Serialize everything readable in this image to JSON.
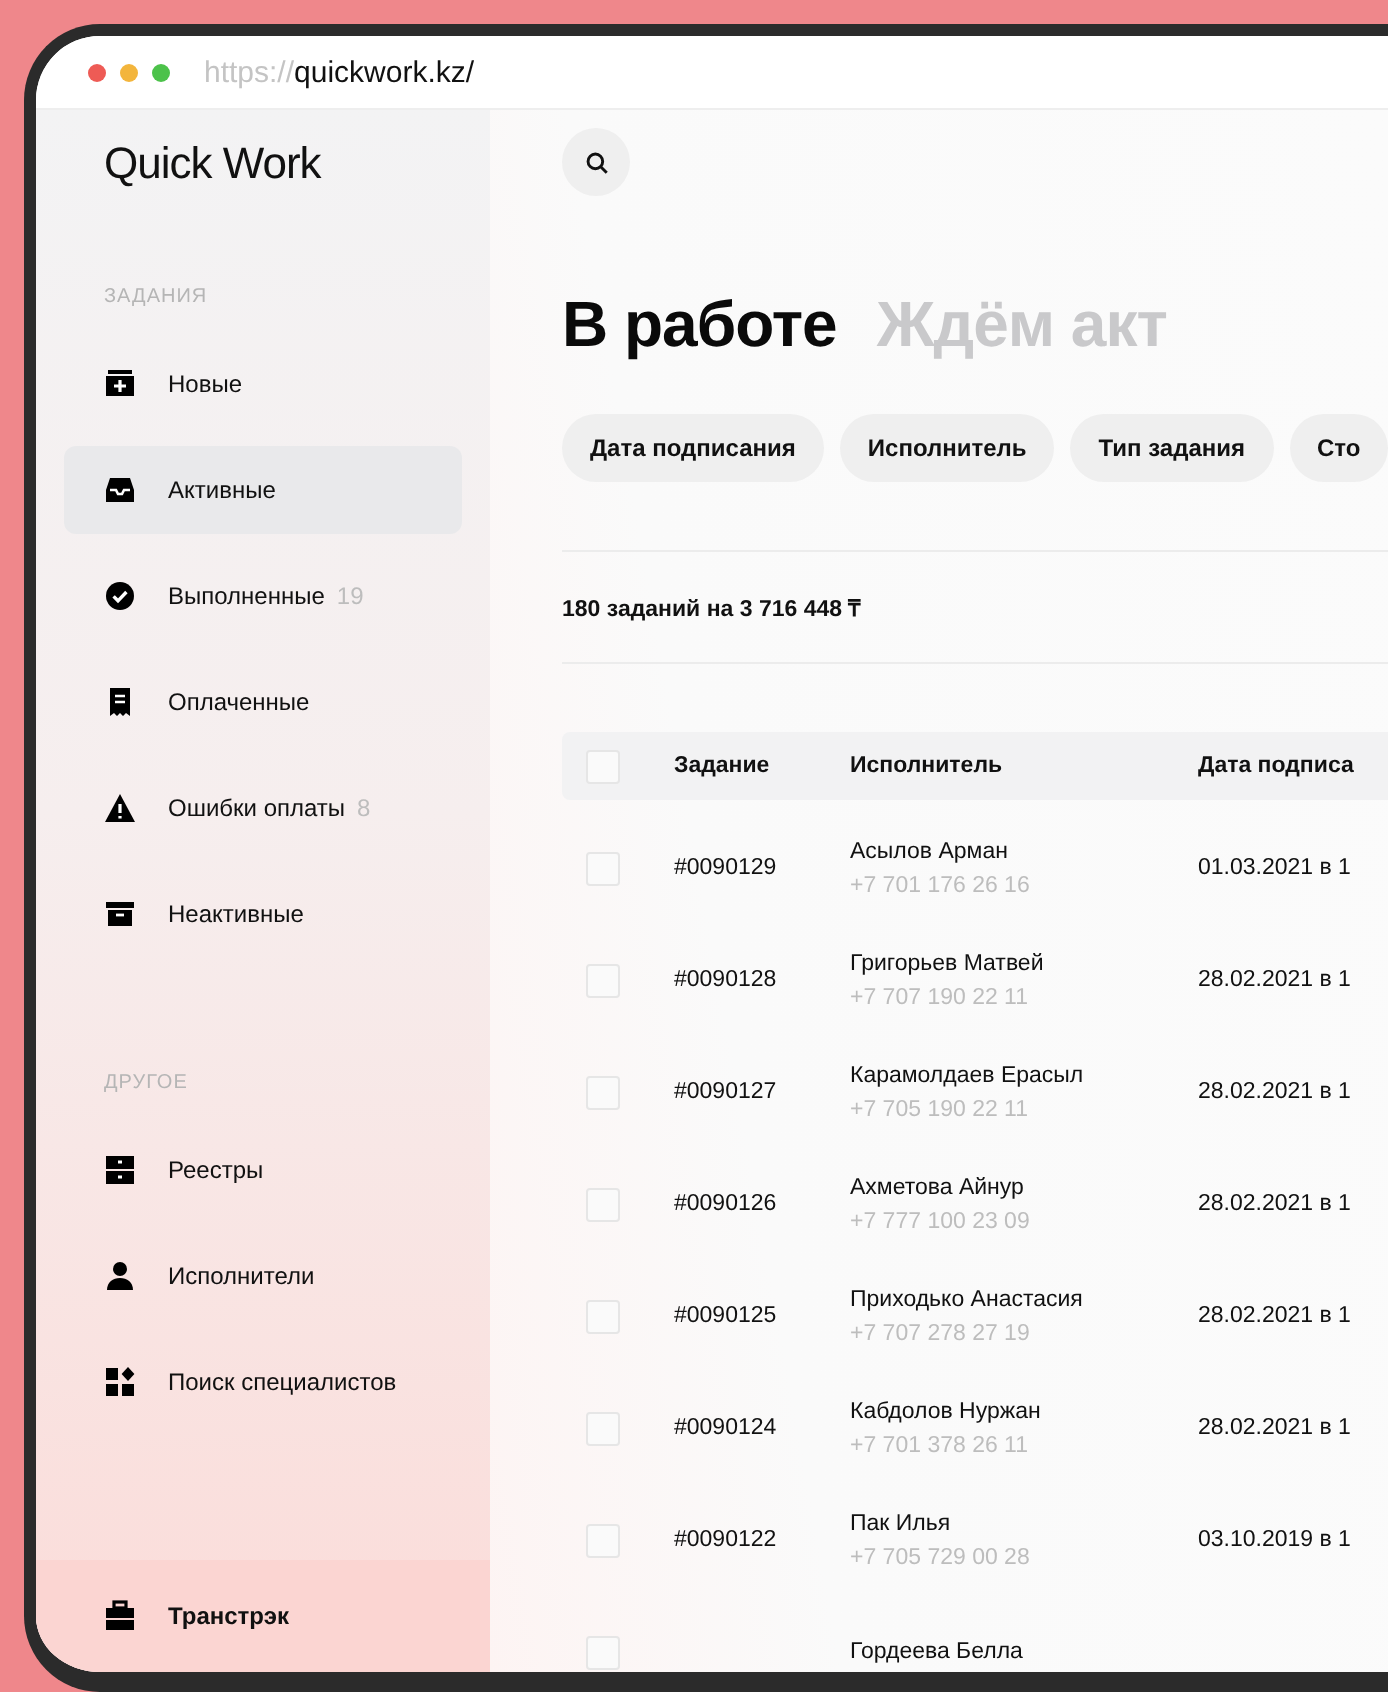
{
  "browser": {
    "url_scheme": "https://",
    "url_host": "quickwork.kz/"
  },
  "sidebar": {
    "logo": "Quick Work",
    "sections": [
      {
        "title": "ЗАДАНИЯ",
        "items": [
          {
            "label": "Новые",
            "selected": false
          },
          {
            "label": "Активные",
            "selected": true
          },
          {
            "label": "Выполненные",
            "count": "19",
            "selected": false
          },
          {
            "label": "Оплаченные",
            "selected": false
          },
          {
            "label": "Ошибки оплаты",
            "count": "8",
            "selected": false
          },
          {
            "label": "Неактивные",
            "selected": false
          }
        ]
      },
      {
        "title": "ДРУГОЕ",
        "items": [
          {
            "label": "Реестры",
            "selected": false
          },
          {
            "label": "Исполнители",
            "selected": false
          },
          {
            "label": "Поиск специалистов",
            "selected": false
          }
        ]
      }
    ],
    "company": "Транстрэк"
  },
  "main": {
    "tabs": [
      {
        "label": "В работе",
        "selected": true
      },
      {
        "label": "Ждём акт",
        "selected": false
      }
    ],
    "filters": [
      "Дата подписания",
      "Исполнитель",
      "Тип задания",
      "Сто"
    ],
    "summary": "180 заданий на 3 716 448 ₸",
    "table": {
      "all_checked": false,
      "columns": [
        "Задание",
        "Исполнитель",
        "Дата подписа"
      ],
      "rows": [
        {
          "checked": false,
          "task": "#0090129",
          "name": "Асылов Арман",
          "phone": "+7 701 176 26 16",
          "date": "01.03.2021 в 1"
        },
        {
          "checked": false,
          "task": "#0090128",
          "name": "Григорьев Матвей",
          "phone": "+7 707 190 22 11",
          "date": "28.02.2021 в 1"
        },
        {
          "checked": false,
          "task": "#0090127",
          "name": "Карамолдаев Ерасыл",
          "phone": "+7 705 190 22 11",
          "date": "28.02.2021 в 1"
        },
        {
          "checked": false,
          "task": "#0090126",
          "name": "Ахметова Айнур",
          "phone": "+7 777 100 23 09",
          "date": "28.02.2021 в 1"
        },
        {
          "checked": false,
          "task": "#0090125",
          "name": "Приходько Анастасия",
          "phone": "+7 707 278 27 19",
          "date": "28.02.2021 в 1"
        },
        {
          "checked": false,
          "task": "#0090124",
          "name": "Кабдолов Нуржан",
          "phone": "+7 701 378 26 11",
          "date": "28.02.2021 в 1"
        },
        {
          "checked": false,
          "task": "#0090122",
          "name": "Пак Илья",
          "phone": "+7 705 729 00 28",
          "date": "03.10.2019 в 1"
        },
        {
          "checked": false,
          "task": "",
          "name": "Гордеева Белла"
        }
      ]
    }
  }
}
